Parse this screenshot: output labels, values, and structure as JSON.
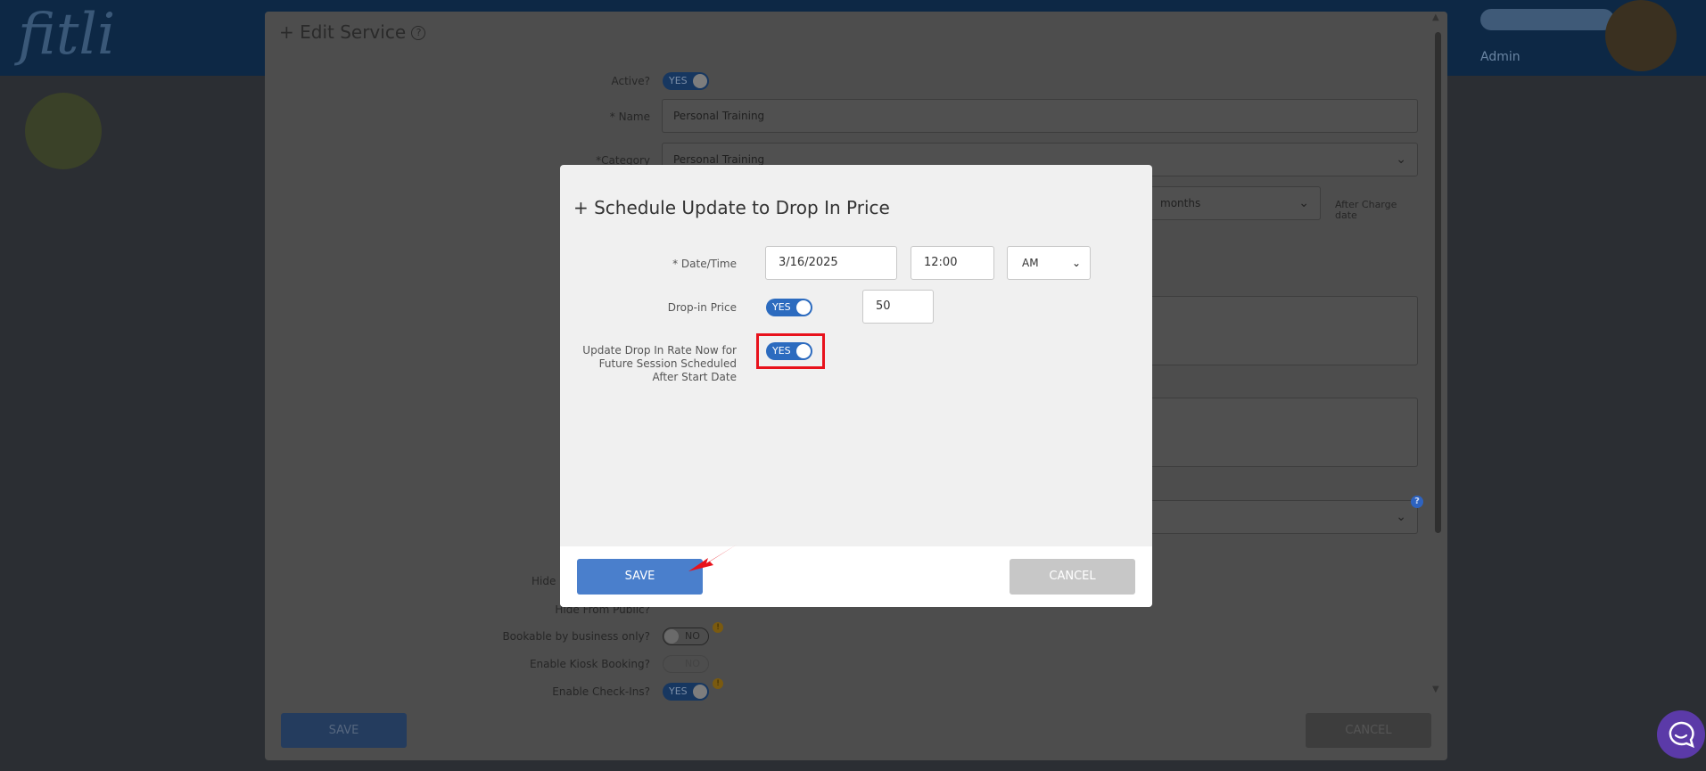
{
  "app": {
    "logo": "fitli",
    "admin_label": "Admin"
  },
  "edit_service": {
    "title": "+ Edit Service",
    "fields": {
      "active_label": "Active?",
      "active_toggle": "YES",
      "name_label": "* Name",
      "name_value": "Personal Training",
      "category_label": "*Category",
      "category_value": "Personal Training",
      "months_value": "months",
      "after_charge_label": "After Charge date",
      "hide_from_public_label": "Hide From Public?",
      "bookable_label": "Bookable by business only?",
      "bookable_toggle": "NO",
      "kiosk_label": "Enable Kiosk Booking?",
      "kiosk_toggle": "NO",
      "checkins_label": "Enable Check-Ins?",
      "checkins_toggle": "YES",
      "hide_partial": "Hide"
    },
    "save_label": "SAVE",
    "cancel_label": "CANCEL"
  },
  "modal": {
    "title": "+ Schedule Update to Drop In Price",
    "date_time_label": "* Date/Time",
    "date_value": "3/16/2025",
    "time_value": "12:00",
    "ampm_value": "AM",
    "drop_in_price_label": "Drop-in Price",
    "drop_in_toggle": "YES",
    "drop_in_price_value": "50",
    "update_rate_label": "Update Drop In Rate Now for Future Session Scheduled After Start Date",
    "update_rate_toggle": "YES",
    "save_label": "SAVE",
    "cancel_label": "CANCEL"
  },
  "colors": {
    "primary_blue": "#4a7fcc",
    "toggle_blue": "#2c6bbf",
    "highlight_red": "#e8121c",
    "cancel_gray": "#c7c7c7",
    "chat_purple": "#5b3aa8"
  }
}
